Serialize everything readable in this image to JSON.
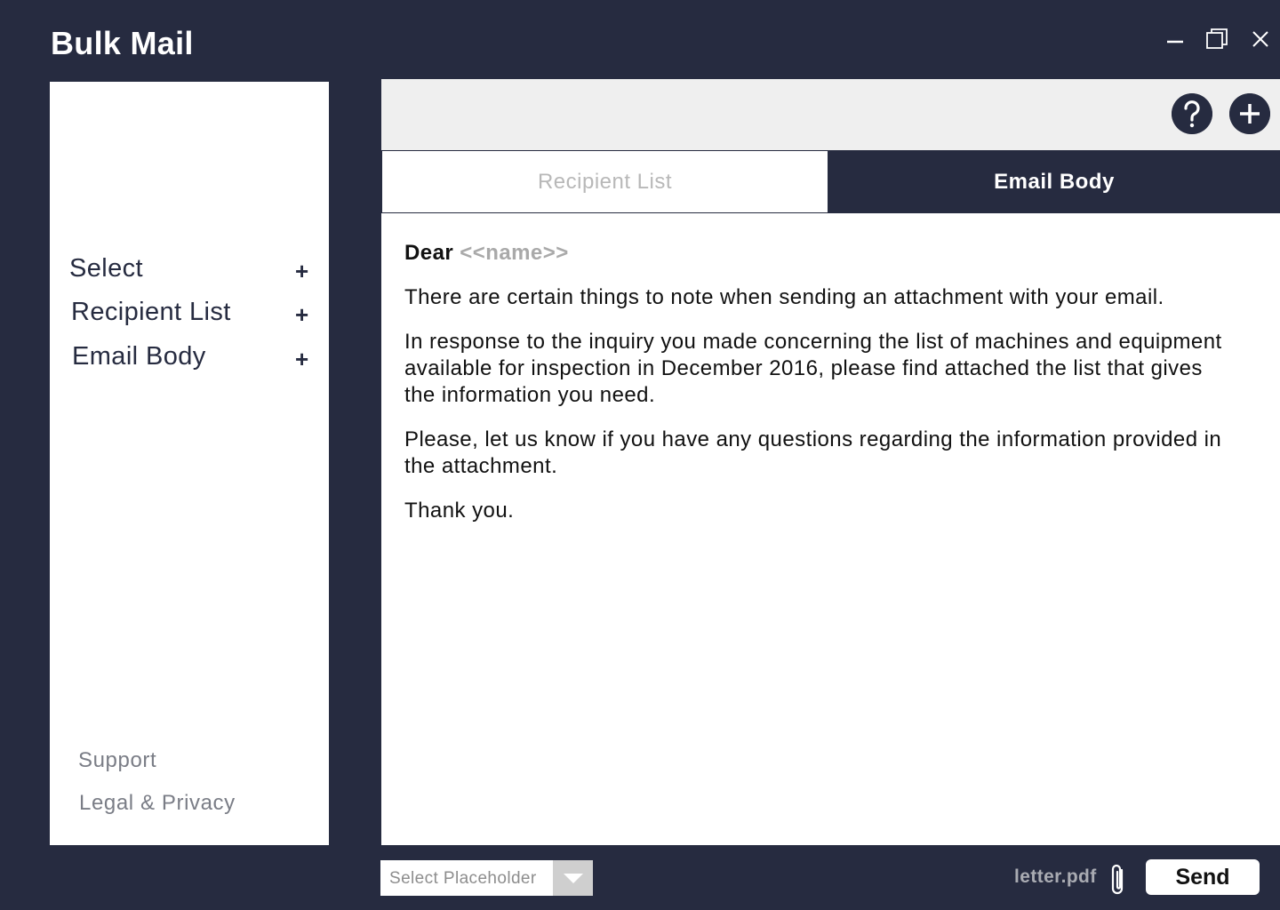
{
  "app": {
    "title": "Bulk Mail"
  },
  "window_controls": {
    "minimize_icon": "minimize-icon",
    "maximize_icon": "restore-icon",
    "close_icon": "close-icon"
  },
  "sidebar": {
    "items": [
      {
        "label": "Select",
        "action": "+"
      },
      {
        "label": "Recipient List",
        "action": "+"
      },
      {
        "label": "Email Body",
        "action": "+"
      }
    ],
    "footer_links": [
      "Support",
      "Legal & Privacy"
    ]
  },
  "toolbar": {
    "help_icon": "question-icon",
    "add_icon": "plus-icon"
  },
  "tabs": [
    {
      "label": "Recipient List",
      "active": false
    },
    {
      "label": "Email Body",
      "active": true
    }
  ],
  "email": {
    "greeting": "Dear",
    "name_placeholder": "<<name>>",
    "paragraphs": [
      "There are certain things to note when sending an attachment with your email.",
      "In response to the inquiry you made concerning the list of machines and equipment available for inspection in December 2016, please find attached the list that gives the information you need.",
      "Please, let us know if you have any questions regarding the information provided in the attachment.",
      "Thank you."
    ]
  },
  "bottom_bar": {
    "placeholder_select": "Select Placeholder",
    "attachment_name": "letter.pdf",
    "send_label": "Send"
  },
  "colors": {
    "navy": "#262b40",
    "panel": "#ffffff",
    "toolbar": "#efefef",
    "muted": "#a9a9a9"
  }
}
